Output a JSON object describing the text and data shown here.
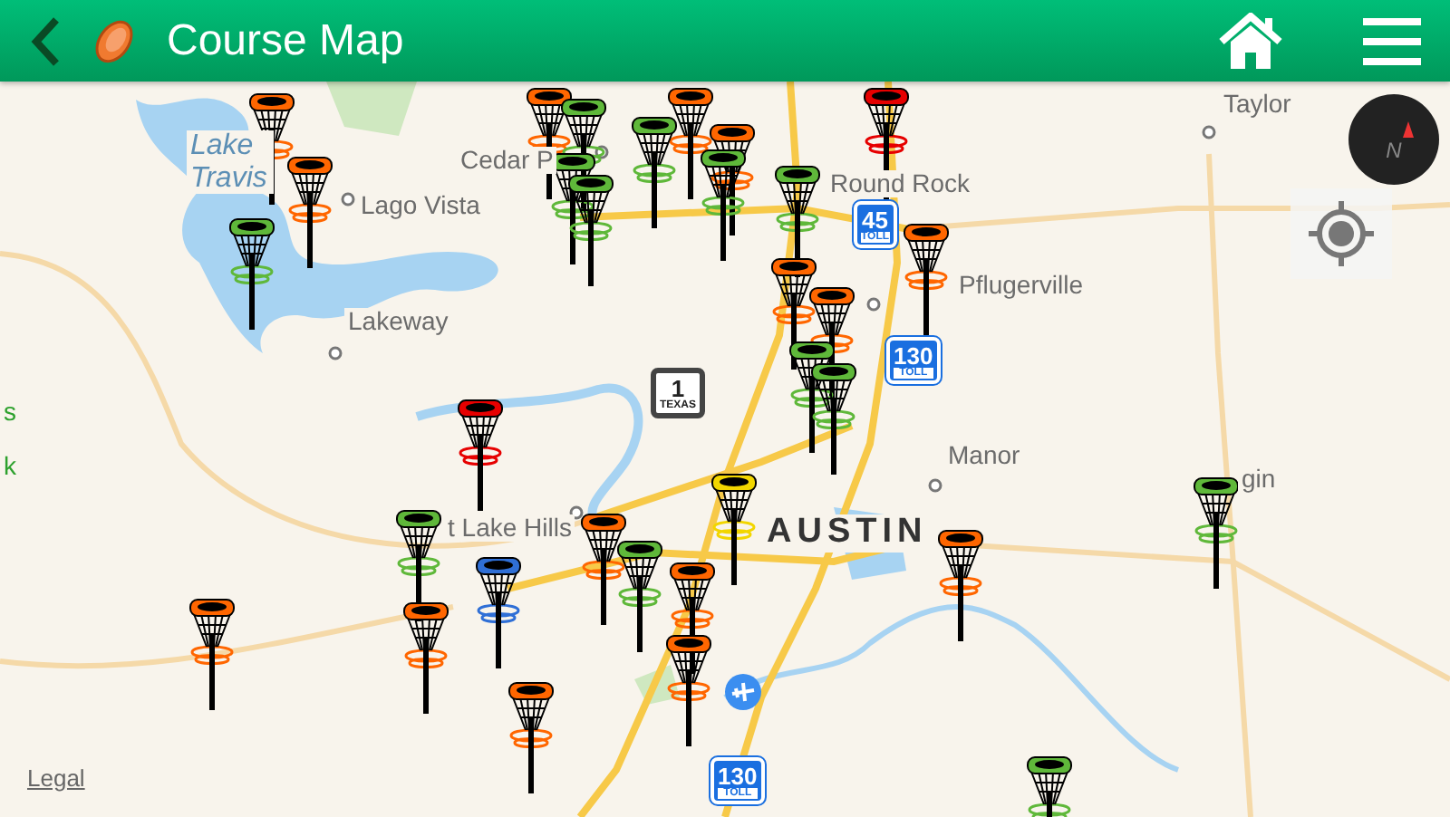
{
  "header": {
    "title": "Course Map"
  },
  "map": {
    "places": [
      {
        "text": "Lake Travis",
        "kind": "lake"
      },
      {
        "text": "Cedar P",
        "kind": "town"
      },
      {
        "text": "Lago Vista",
        "kind": "town"
      },
      {
        "text": "Round Rock",
        "kind": "town"
      },
      {
        "text": "Taylor",
        "kind": "town"
      },
      {
        "text": "Pflugerville",
        "kind": "town"
      },
      {
        "text": "Lakeway",
        "kind": "town"
      },
      {
        "text": "s",
        "kind": "park"
      },
      {
        "text": "k",
        "kind": "park"
      },
      {
        "text": "t Lake Hills",
        "kind": "town"
      },
      {
        "text": "AUSTIN",
        "kind": "city"
      },
      {
        "text": "Manor",
        "kind": "town"
      },
      {
        "text": "gin",
        "kind": "town"
      }
    ],
    "shields": [
      {
        "number": "45",
        "sub": "TOLL",
        "kind": "toll"
      },
      {
        "number": "130",
        "sub": "TOLL",
        "kind": "toll"
      },
      {
        "number": "1",
        "sub": "TEXAS",
        "kind": "state"
      },
      {
        "number": "130",
        "sub": "TOLL",
        "kind": "toll"
      }
    ],
    "pins": [
      {
        "color": "#ff6600"
      },
      {
        "color": "#ff6600"
      },
      {
        "color": "#5fb83a"
      },
      {
        "color": "#ff6600"
      },
      {
        "color": "#5fb83a"
      },
      {
        "color": "#ff6600"
      },
      {
        "color": "#5fb83a"
      },
      {
        "color": "#ff6600"
      },
      {
        "color": "#5fb83a"
      },
      {
        "color": "#5fb83a"
      },
      {
        "color": "#5fb83a"
      },
      {
        "color": "#5fb83a"
      },
      {
        "color": "#e60000"
      },
      {
        "color": "#ff6600"
      },
      {
        "color": "#ff6600"
      },
      {
        "color": "#ff6600"
      },
      {
        "color": "#5fb83a"
      },
      {
        "color": "#5fb83a"
      },
      {
        "color": "#e60000"
      },
      {
        "color": "#f2d600"
      },
      {
        "color": "#5fb83a"
      },
      {
        "color": "#ff6600"
      },
      {
        "color": "#5fb83a"
      },
      {
        "color": "#2f6fd6"
      },
      {
        "color": "#ff6600"
      },
      {
        "color": "#ff6600"
      },
      {
        "color": "#5fb83a"
      },
      {
        "color": "#ff6600"
      },
      {
        "color": "#ff6600"
      },
      {
        "color": "#ff6600"
      },
      {
        "color": "#ff6600"
      },
      {
        "color": "#5fb83a"
      }
    ],
    "compass": {
      "label": "N"
    },
    "legal": "Legal"
  }
}
